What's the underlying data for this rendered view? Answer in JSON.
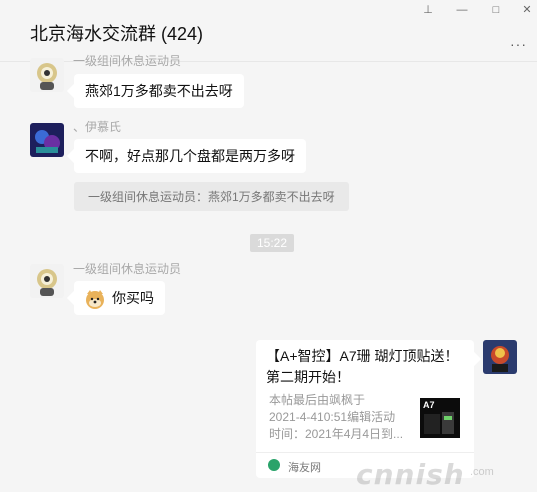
{
  "window": {
    "title": "北京海水交流群 (424)",
    "controls": {
      "pin": "⊥",
      "minimize": "—",
      "maximize": "□",
      "close": "✕"
    },
    "more_icon": "···"
  },
  "messages": [
    {
      "sender": "一级组间休息运动员",
      "text": "燕郊1万多都卖不出去呀"
    },
    {
      "sender": "、伊慕氏",
      "text": "不啊，好点那几个盘都是两万多呀",
      "quote": "一级组间休息运动员：燕郊1万多都卖不出去呀"
    },
    {
      "sender": "一级组间休息运动员",
      "emoji": "doge",
      "text": "你买吗"
    }
  ],
  "timestamp": "15:22",
  "card": {
    "title": "【A+智控】A7珊 瑚灯顶贴送！第二期开始！",
    "desc_lines": [
      "本帖最后由飒枫于",
      "2021-4-410:51编辑活动",
      "时间：2021年4月4日到..."
    ],
    "thumb_text": "A7",
    "source": "海友网"
  },
  "watermark": {
    "text": "cnnish",
    "small": ".com"
  },
  "colors": {
    "background": "#f5f5f5",
    "bubble": "#ffffff",
    "timestamp_bg": "#dadada"
  }
}
